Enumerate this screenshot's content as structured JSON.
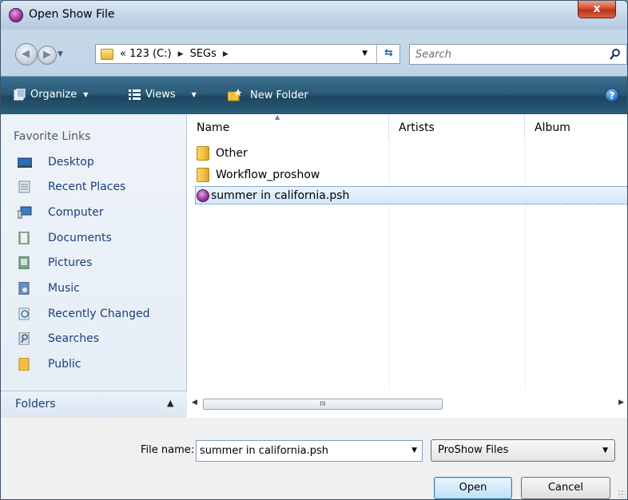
{
  "window": {
    "title": "Open Show File",
    "close_label": "x"
  },
  "address": {
    "crumbs": [
      "« 123 (C:)",
      "SEGs"
    ],
    "search_placeholder": "Search"
  },
  "toolbar": {
    "organize": "Organize",
    "views": "Views",
    "new_folder": "New Folder",
    "help": "?"
  },
  "sidebar": {
    "header": "Favorite Links",
    "items": [
      {
        "label": "Desktop",
        "icon": "desktop-icon"
      },
      {
        "label": "Recent Places",
        "icon": "recent-places-icon"
      },
      {
        "label": "Computer",
        "icon": "computer-icon"
      },
      {
        "label": "Documents",
        "icon": "documents-icon"
      },
      {
        "label": "Pictures",
        "icon": "pictures-icon"
      },
      {
        "label": "Music",
        "icon": "music-icon"
      },
      {
        "label": "Recently Changed",
        "icon": "recently-changed-icon"
      },
      {
        "label": "Searches",
        "icon": "searches-icon"
      },
      {
        "label": "Public",
        "icon": "public-folder-icon"
      }
    ],
    "folders_label": "Folders"
  },
  "files": {
    "columns": [
      "Name",
      "Artists",
      "Album"
    ],
    "rows": [
      {
        "name": "Other",
        "type": "folder"
      },
      {
        "name": "Workflow_proshow",
        "type": "folder"
      },
      {
        "name": "summer in california.psh",
        "type": "psh",
        "selected": true
      }
    ],
    "scroll_thumb": "III"
  },
  "bottom": {
    "file_name_label": "File name:",
    "file_name_value": "summer in california.psh",
    "file_type": "ProShow Files",
    "open_label": "Open",
    "cancel_label": "Cancel"
  },
  "colors": {
    "toolbar": "#2b5a76",
    "link": "#1b3f7a",
    "selection": "#d2e6fa"
  }
}
